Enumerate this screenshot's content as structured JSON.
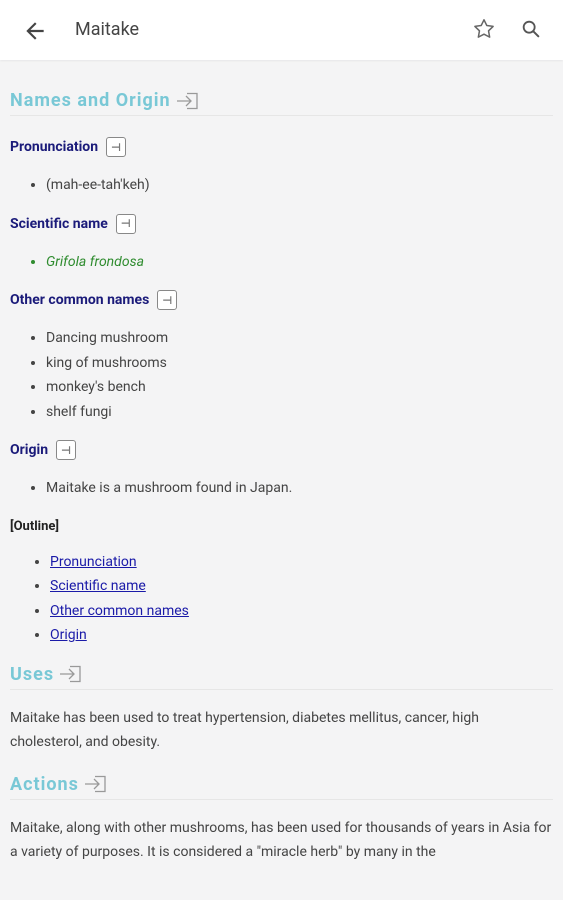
{
  "header": {
    "title": "Maitake"
  },
  "sections": {
    "names_origin": {
      "heading": "Names and Origin",
      "pronunciation": {
        "title": "Pronunciation",
        "items": [
          "(mah-ee-tah'keh)"
        ]
      },
      "scientific_name": {
        "title": "Scientific name",
        "items": [
          "Grifola frondosa"
        ]
      },
      "other_common_names": {
        "title": "Other common names",
        "items": [
          "Dancing mushroom",
          "king of mushrooms",
          "monkey's bench",
          "shelf fungi"
        ]
      },
      "origin": {
        "title": "Origin",
        "items": [
          "Maitake is a mushroom found in Japan."
        ]
      },
      "outline": {
        "title": "[Outline]",
        "links": [
          "Pronunciation",
          "Scientific name",
          "Other common names",
          "Origin"
        ]
      }
    },
    "uses": {
      "heading": "Uses",
      "text": "Maitake has been used to treat hypertension, diabetes mellitus, cancer, high cholesterol, and obesity."
    },
    "actions": {
      "heading": "Actions",
      "text": "Maitake, along with other mushrooms, has been used for thousands of years in Asia for a variety of purposes. It is considered a \"miracle herb\" by many in the"
    }
  },
  "icons": {
    "back": "arrow-left-icon",
    "favorite": "star-outline-icon",
    "search": "search-icon",
    "section": "section-link-icon",
    "expand": "expand-box-icon"
  },
  "colors": {
    "section_heading": "#79c8d6",
    "subheading": "#1b1b7a",
    "scientific_name": "#2f8c2f",
    "link": "#1a1aa8"
  }
}
